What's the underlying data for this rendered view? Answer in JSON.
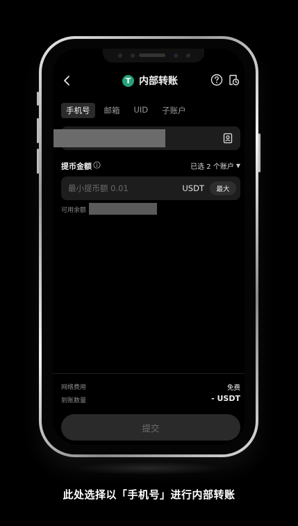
{
  "header": {
    "title": "内部转账",
    "coin_glyph": "T",
    "coin_color": "#26a17b"
  },
  "tabs": [
    {
      "label": "手机号",
      "active": true
    },
    {
      "label": "邮箱",
      "active": false
    },
    {
      "label": "UID",
      "active": false
    },
    {
      "label": "子账户",
      "active": false
    }
  ],
  "recipient": {
    "value": ""
  },
  "amount": {
    "label": "提币金额",
    "accounts_selected": "已选 2 个账户",
    "placeholder": "最小提币额 0.01",
    "unit": "USDT",
    "max_label": "最大",
    "available_label": "可用余额"
  },
  "summary": {
    "fee_label": "网络费用",
    "fee_value": "免费",
    "receive_label": "到账数量",
    "receive_value": "- USDT"
  },
  "submit_label": "提交",
  "caption": "此处选择以「手机号」进行内部转账",
  "colors": {
    "background": "#000000",
    "field_bg": "#1d1d1d",
    "accent": "#26a17b"
  }
}
